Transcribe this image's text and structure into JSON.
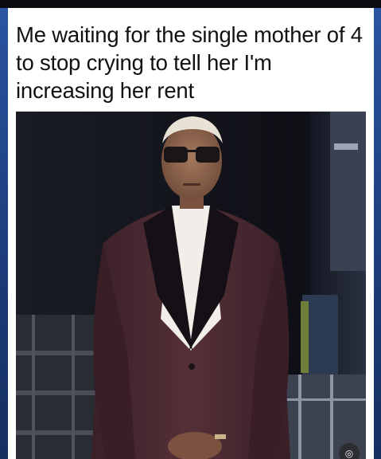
{
  "post": {
    "caption": "Me waiting for the single mother of 4 to stop crying to tell her I'm increasing her rent"
  },
  "icons": {
    "lens": "visual-search-icon"
  },
  "colors": {
    "background": "#1e3f7a",
    "card": "#ffffff",
    "suit": "#4a2a33",
    "lapel": "#141016"
  }
}
